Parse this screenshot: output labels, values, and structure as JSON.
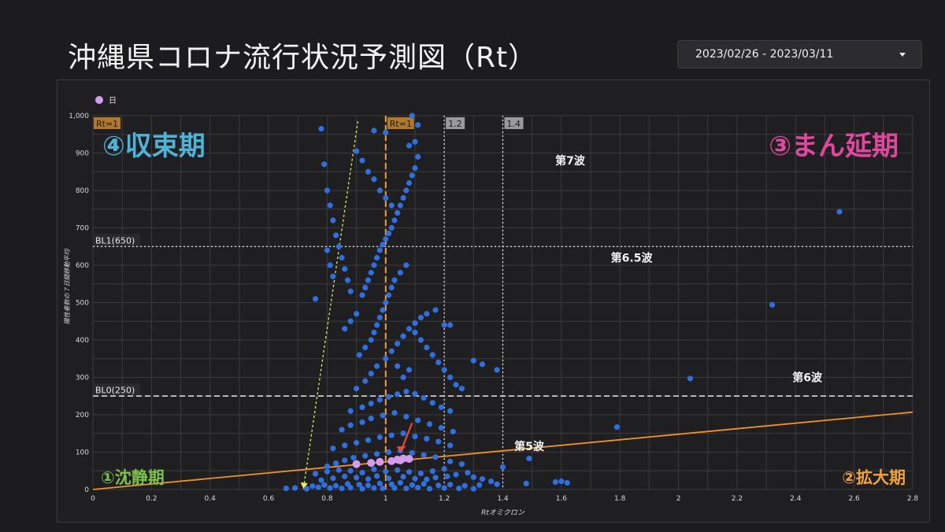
{
  "page": {
    "title": "沖縄県コロナ流行状況予測図（Rt）",
    "date_range": "2023/02/26 - 2023/03/11"
  },
  "chart_data": {
    "type": "scatter",
    "xlabel": "Rtオミクロン",
    "ylabel": "陽性者数の７日間移動平均",
    "xlim": [
      0,
      2.8
    ],
    "ylim": [
      0,
      1000
    ],
    "x_ticks": [
      "0",
      "0.2",
      "0.4",
      "0.6",
      "0.8",
      "1",
      "1.2",
      "1.4",
      "1.6",
      "1.8",
      "2",
      "2.2",
      "2.4",
      "2.6",
      "2.8"
    ],
    "y_ticks": [
      "0",
      "100",
      "200",
      "300",
      "400",
      "500",
      "600",
      "700",
      "800",
      "900",
      "1,000"
    ],
    "grid": true,
    "legend": {
      "placement": "top-left",
      "label": "日",
      "color": "#d59bf0"
    },
    "colors": {
      "history": "#2f6fe0",
      "recent": "#d59bf0",
      "trend": "#ef8f2a",
      "wave_arrow": "#e5ef5a",
      "highlight_arrow": "#e24a3a",
      "rt1_line": "#f0a040"
    },
    "vlines": [
      {
        "x": 1.0,
        "label": "Rt=1",
        "style": "dashed-orange"
      },
      {
        "x": 1.2,
        "label": "1.2",
        "style": "dotted"
      },
      {
        "x": 1.4,
        "label": "1.4",
        "style": "dotted"
      }
    ],
    "hlines": [
      {
        "y": 650,
        "label": "BL1(650)",
        "style": "dotted"
      },
      {
        "y": 250,
        "label": "BL0(250)",
        "style": "dashed"
      }
    ],
    "rt1_left_label": "Rt=1",
    "trend_line": {
      "x": [
        0,
        2.8
      ],
      "y": [
        0,
        207
      ]
    },
    "quadrants": {
      "q4": "④収束期",
      "q3": "③まん延期",
      "q1": "①沈静期",
      "q2": "②拡大期"
    },
    "wave_labels": [
      {
        "text": "第7波",
        "x": 1.63,
        "y": 870
      },
      {
        "text": "第6.5波",
        "x": 1.84,
        "y": 610
      },
      {
        "text": "第6波",
        "x": 2.44,
        "y": 290
      },
      {
        "text": "第5波",
        "x": 1.49,
        "y": 105
      }
    ],
    "series": [
      {
        "name": "日",
        "role": "recent",
        "points": [
          [
            0.9,
            68
          ],
          [
            0.95,
            71
          ],
          [
            0.98,
            74
          ],
          [
            1.02,
            76
          ],
          [
            1.04,
            80
          ],
          [
            1.06,
            83
          ],
          [
            1.08,
            82
          ],
          [
            1.05,
            78
          ]
        ]
      },
      {
        "role": "history",
        "points": [
          [
            0.73,
            2
          ],
          [
            0.77,
            6
          ],
          [
            0.81,
            4
          ],
          [
            0.85,
            3
          ],
          [
            0.88,
            5
          ],
          [
            0.92,
            2
          ],
          [
            0.96,
            4
          ],
          [
            0.99,
            3
          ],
          [
            1.03,
            4
          ],
          [
            1.07,
            3
          ],
          [
            1.11,
            5
          ],
          [
            1.15,
            2
          ],
          [
            1.2,
            4
          ],
          [
            1.25,
            3
          ],
          [
            1.3,
            2
          ],
          [
            0.66,
            3
          ],
          [
            0.69,
            4
          ],
          [
            0.75,
            9
          ],
          [
            0.79,
            12
          ],
          [
            0.83,
            10
          ],
          [
            0.87,
            15
          ],
          [
            0.91,
            13
          ],
          [
            0.94,
            11
          ],
          [
            0.98,
            16
          ],
          [
            1.02,
            14
          ],
          [
            1.05,
            18
          ],
          [
            1.09,
            12
          ],
          [
            1.13,
            15
          ],
          [
            1.18,
            11
          ],
          [
            1.22,
            13
          ],
          [
            1.27,
            10
          ],
          [
            1.32,
            12
          ],
          [
            1.38,
            14
          ],
          [
            1.33,
            28
          ],
          [
            1.36,
            22
          ],
          [
            1.48,
            16
          ],
          [
            1.58,
            20
          ],
          [
            1.6,
            22
          ],
          [
            1.62,
            18
          ],
          [
            0.78,
            25
          ],
          [
            0.82,
            30
          ],
          [
            0.86,
            35
          ],
          [
            0.9,
            32
          ],
          [
            0.94,
            28
          ],
          [
            0.97,
            36
          ],
          [
            1.01,
            30
          ],
          [
            1.06,
            34
          ],
          [
            1.1,
            29
          ],
          [
            1.14,
            27
          ],
          [
            1.17,
            32
          ],
          [
            1.21,
            35
          ],
          [
            1.24,
            40
          ],
          [
            1.28,
            45
          ],
          [
            1.3,
            33
          ],
          [
            0.76,
            42
          ],
          [
            0.8,
            48
          ],
          [
            0.84,
            52
          ],
          [
            0.88,
            50
          ],
          [
            0.92,
            45
          ],
          [
            0.96,
            54
          ],
          [
            1.0,
            48
          ],
          [
            1.04,
            52
          ],
          [
            1.08,
            47
          ],
          [
            1.12,
            43
          ],
          [
            1.16,
            49
          ],
          [
            1.2,
            55
          ],
          [
            1.4,
            60
          ],
          [
            1.49,
            83
          ],
          [
            0.8,
            62
          ],
          [
            0.83,
            70
          ],
          [
            0.86,
            78
          ],
          [
            0.89,
            85
          ],
          [
            0.93,
            90
          ],
          [
            0.97,
            95
          ],
          [
            1.01,
            100
          ],
          [
            1.05,
            104
          ],
          [
            1.09,
            98
          ],
          [
            1.13,
            92
          ],
          [
            1.17,
            87
          ],
          [
            1.22,
            75
          ],
          [
            1.26,
            68
          ],
          [
            0.82,
            110
          ],
          [
            0.86,
            118
          ],
          [
            0.9,
            125
          ],
          [
            0.94,
            132
          ],
          [
            0.98,
            140
          ],
          [
            1.02,
            145
          ],
          [
            1.06,
            150
          ],
          [
            1.1,
            142
          ],
          [
            1.14,
            136
          ],
          [
            1.18,
            128
          ],
          [
            1.22,
            118
          ],
          [
            0.85,
            160
          ],
          [
            0.88,
            172
          ],
          [
            0.92,
            180
          ],
          [
            0.95,
            190
          ],
          [
            0.99,
            198
          ],
          [
            1.03,
            205
          ],
          [
            1.07,
            195
          ],
          [
            1.11,
            185
          ],
          [
            1.15,
            175
          ],
          [
            1.19,
            165
          ],
          [
            1.23,
            155
          ],
          [
            0.88,
            210
          ],
          [
            0.92,
            220
          ],
          [
            0.95,
            230
          ],
          [
            0.98,
            240
          ],
          [
            1.01,
            248
          ],
          [
            1.04,
            255
          ],
          [
            1.07,
            262
          ],
          [
            1.1,
            256
          ],
          [
            1.13,
            245
          ],
          [
            1.16,
            232
          ],
          [
            1.19,
            220
          ],
          [
            1.22,
            210
          ],
          [
            0.9,
            270
          ],
          [
            0.93,
            290
          ],
          [
            0.95,
            310
          ],
          [
            0.97,
            330
          ],
          [
            1.0,
            350
          ],
          [
            1.02,
            370
          ],
          [
            1.04,
            390
          ],
          [
            1.06,
            410
          ],
          [
            1.08,
            430
          ],
          [
            1.1,
            445
          ],
          [
            1.12,
            460
          ],
          [
            1.14,
            470
          ],
          [
            1.17,
            480
          ],
          [
            1.2,
            440
          ],
          [
            0.91,
            360
          ],
          [
            0.93,
            380
          ],
          [
            0.95,
            400
          ],
          [
            0.96,
            420
          ],
          [
            0.97,
            440
          ],
          [
            0.98,
            460
          ],
          [
            0.99,
            480
          ],
          [
            1.0,
            500
          ],
          [
            1.01,
            520
          ],
          [
            1.02,
            540
          ],
          [
            1.03,
            560
          ],
          [
            1.05,
            580
          ],
          [
            1.07,
            600
          ],
          [
            0.92,
            520
          ],
          [
            0.93,
            540
          ],
          [
            0.94,
            560
          ],
          [
            0.95,
            580
          ],
          [
            0.96,
            600
          ],
          [
            0.97,
            620
          ],
          [
            0.98,
            640
          ],
          [
            0.99,
            655
          ],
          [
            1.0,
            670
          ],
          [
            1.01,
            685
          ],
          [
            1.02,
            700
          ],
          [
            1.03,
            720
          ],
          [
            1.04,
            740
          ],
          [
            1.05,
            760
          ],
          [
            1.06,
            780
          ],
          [
            1.07,
            800
          ],
          [
            1.08,
            820
          ],
          [
            1.09,
            840
          ],
          [
            1.1,
            860
          ],
          [
            1.11,
            890
          ],
          [
            1.1,
            930
          ],
          [
            1.11,
            975
          ],
          [
            0.88,
            530
          ],
          [
            0.87,
            560
          ],
          [
            0.86,
            590
          ],
          [
            0.85,
            620
          ],
          [
            0.84,
            650
          ],
          [
            0.83,
            680
          ],
          [
            0.82,
            720
          ],
          [
            0.81,
            760
          ],
          [
            0.8,
            800
          ],
          [
            0.79,
            870
          ],
          [
            0.78,
            965
          ],
          [
            0.8,
            640
          ],
          [
            0.81,
            600
          ],
          [
            0.82,
            570
          ],
          [
            0.76,
            510
          ],
          [
            0.9,
            470
          ],
          [
            0.88,
            450
          ],
          [
            0.86,
            430
          ],
          [
            1.1,
            420
          ],
          [
            1.12,
            400
          ],
          [
            1.14,
            380
          ],
          [
            1.16,
            360
          ],
          [
            1.18,
            340
          ],
          [
            1.2,
            320
          ],
          [
            1.22,
            300
          ],
          [
            1.24,
            280
          ],
          [
            1.26,
            270
          ],
          [
            1.3,
            345
          ],
          [
            1.33,
            335
          ],
          [
            1.38,
            320
          ],
          [
            1.22,
            440
          ],
          [
            1.06,
            300
          ],
          [
            1.08,
            320
          ],
          [
            1.04,
            330
          ],
          [
            0.9,
            905
          ],
          [
            0.92,
            880
          ],
          [
            0.94,
            850
          ],
          [
            0.96,
            830
          ],
          [
            0.98,
            800
          ],
          [
            1.0,
            780
          ],
          [
            1.02,
            760
          ],
          [
            1.04,
            740
          ],
          [
            0.96,
            960
          ],
          [
            1.0,
            955
          ],
          [
            1.08,
            920
          ],
          [
            1.09,
            1000
          ],
          [
            1.79,
            167
          ],
          [
            2.04,
            297
          ],
          [
            2.32,
            494
          ],
          [
            2.55,
            743
          ]
        ]
      }
    ]
  }
}
